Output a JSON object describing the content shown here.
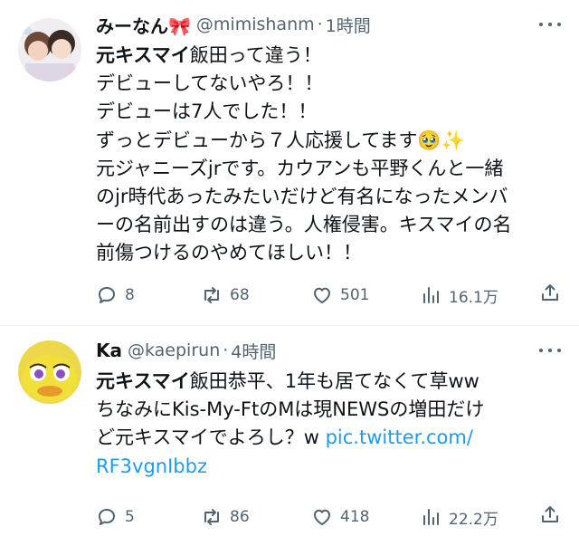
{
  "tweets": [
    {
      "name": "みーなん🎀",
      "handle": "@mimishanm",
      "separator": "·",
      "time": "1時間",
      "lines": [
        {
          "bold": "元キスマイ",
          "text": "飯田って違う！"
        },
        {
          "bold": "",
          "text": "デビューしてないやろ！！"
        },
        {
          "bold": "",
          "text": "デビューは7人でした！！"
        },
        {
          "bold": "",
          "text": "ずっとデビューから７人応援してます🥹✨"
        },
        {
          "bold": "",
          "text": "元ジャニーズjrです。カウアンも平野くんと一緒"
        },
        {
          "bold": "",
          "text": "のjr時代あったみたいだけど有名になったメンバ"
        },
        {
          "bold": "",
          "text": "ーの名前出すのは違う。人権侵害。キスマイの名"
        },
        {
          "bold": "",
          "text": "前傷つけるのやめてほしい！！"
        }
      ],
      "replies": "8",
      "retweets": "68",
      "likes": "501",
      "views": "16.1万"
    },
    {
      "name": "Ka",
      "handle": "@kaepirun",
      "separator": "·",
      "time": "4時間",
      "lines": [
        {
          "bold": "元キスマイ",
          "text": "飯田恭平、1年も居てなくて草ww"
        },
        {
          "bold": "",
          "text": "ちなみにKis-My-FtのMは現NEWSの増田だけ"
        },
        {
          "bold": "",
          "text": "ど元キスマイでよろし？w ",
          "link": "pic.twitter.com/"
        },
        {
          "bold": "",
          "text": "",
          "link": "RF3vgnIbbz"
        }
      ],
      "replies": "5",
      "retweets": "86",
      "likes": "418",
      "views": "22.2万"
    }
  ],
  "colors": {
    "text": "#0f1419",
    "secondary": "#536471",
    "link": "#1d9bf0",
    "divider": "#eff3f4"
  },
  "icons": [
    "reply-icon",
    "retweet-icon",
    "like-icon",
    "views-icon",
    "share-icon",
    "more-icon"
  ]
}
